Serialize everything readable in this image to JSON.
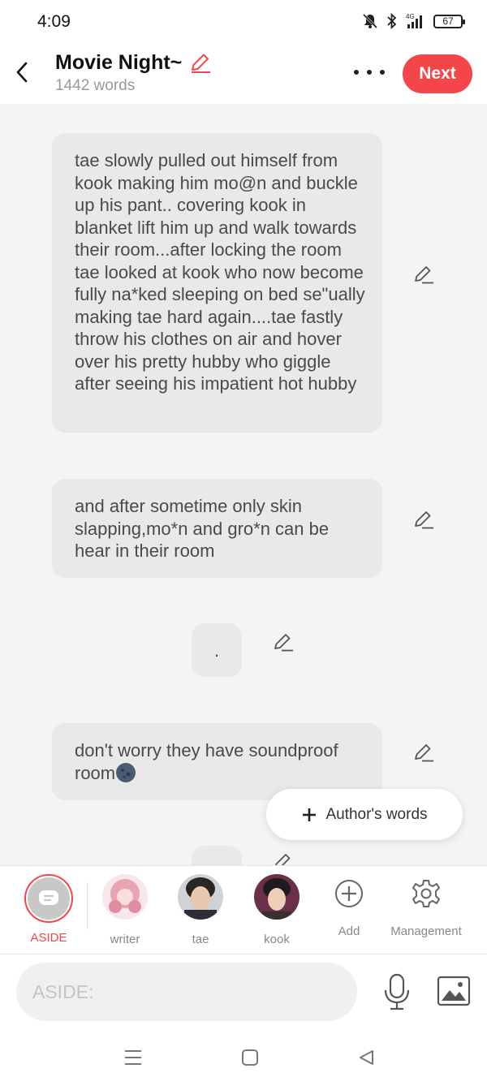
{
  "status_bar": {
    "time": "4:09",
    "battery": "67",
    "network": "4G"
  },
  "header": {
    "title": "Movie Night~",
    "word_count": "1442 words",
    "next_label": "Next"
  },
  "messages": [
    {
      "text": "tae slowly pulled out himself from kook making him mo@n and buckle up his pant.. covering kook in blanket lift him up and walk towards their room...after locking the room tae looked at kook who now become fully na*ked sleeping on bed se\"ually making tae hard again....tae fastly throw his clothes on air and hover over his pretty hubby who giggle after seeing his impatient hot hubby"
    },
    {
      "text": "and after sometime only skin slapping,mo*n and gro*n can be hear in their room"
    },
    {
      "text": "."
    },
    {
      "text": "don't worry they have soundproof room"
    }
  ],
  "author_words_label": "Author's words",
  "characters": [
    {
      "label": "ASIDE",
      "selected": true
    },
    {
      "label": "writer"
    },
    {
      "label": "tae"
    },
    {
      "label": "kook"
    }
  ],
  "tools": [
    {
      "label": "Add",
      "icon": "add-circle-icon"
    },
    {
      "label": "Management",
      "icon": "gear-icon"
    }
  ],
  "input": {
    "placeholder": "ASIDE:"
  },
  "colors": {
    "accent": "#f4464a",
    "bubble": "#e9e9e9",
    "background": "#f4f4f4"
  }
}
